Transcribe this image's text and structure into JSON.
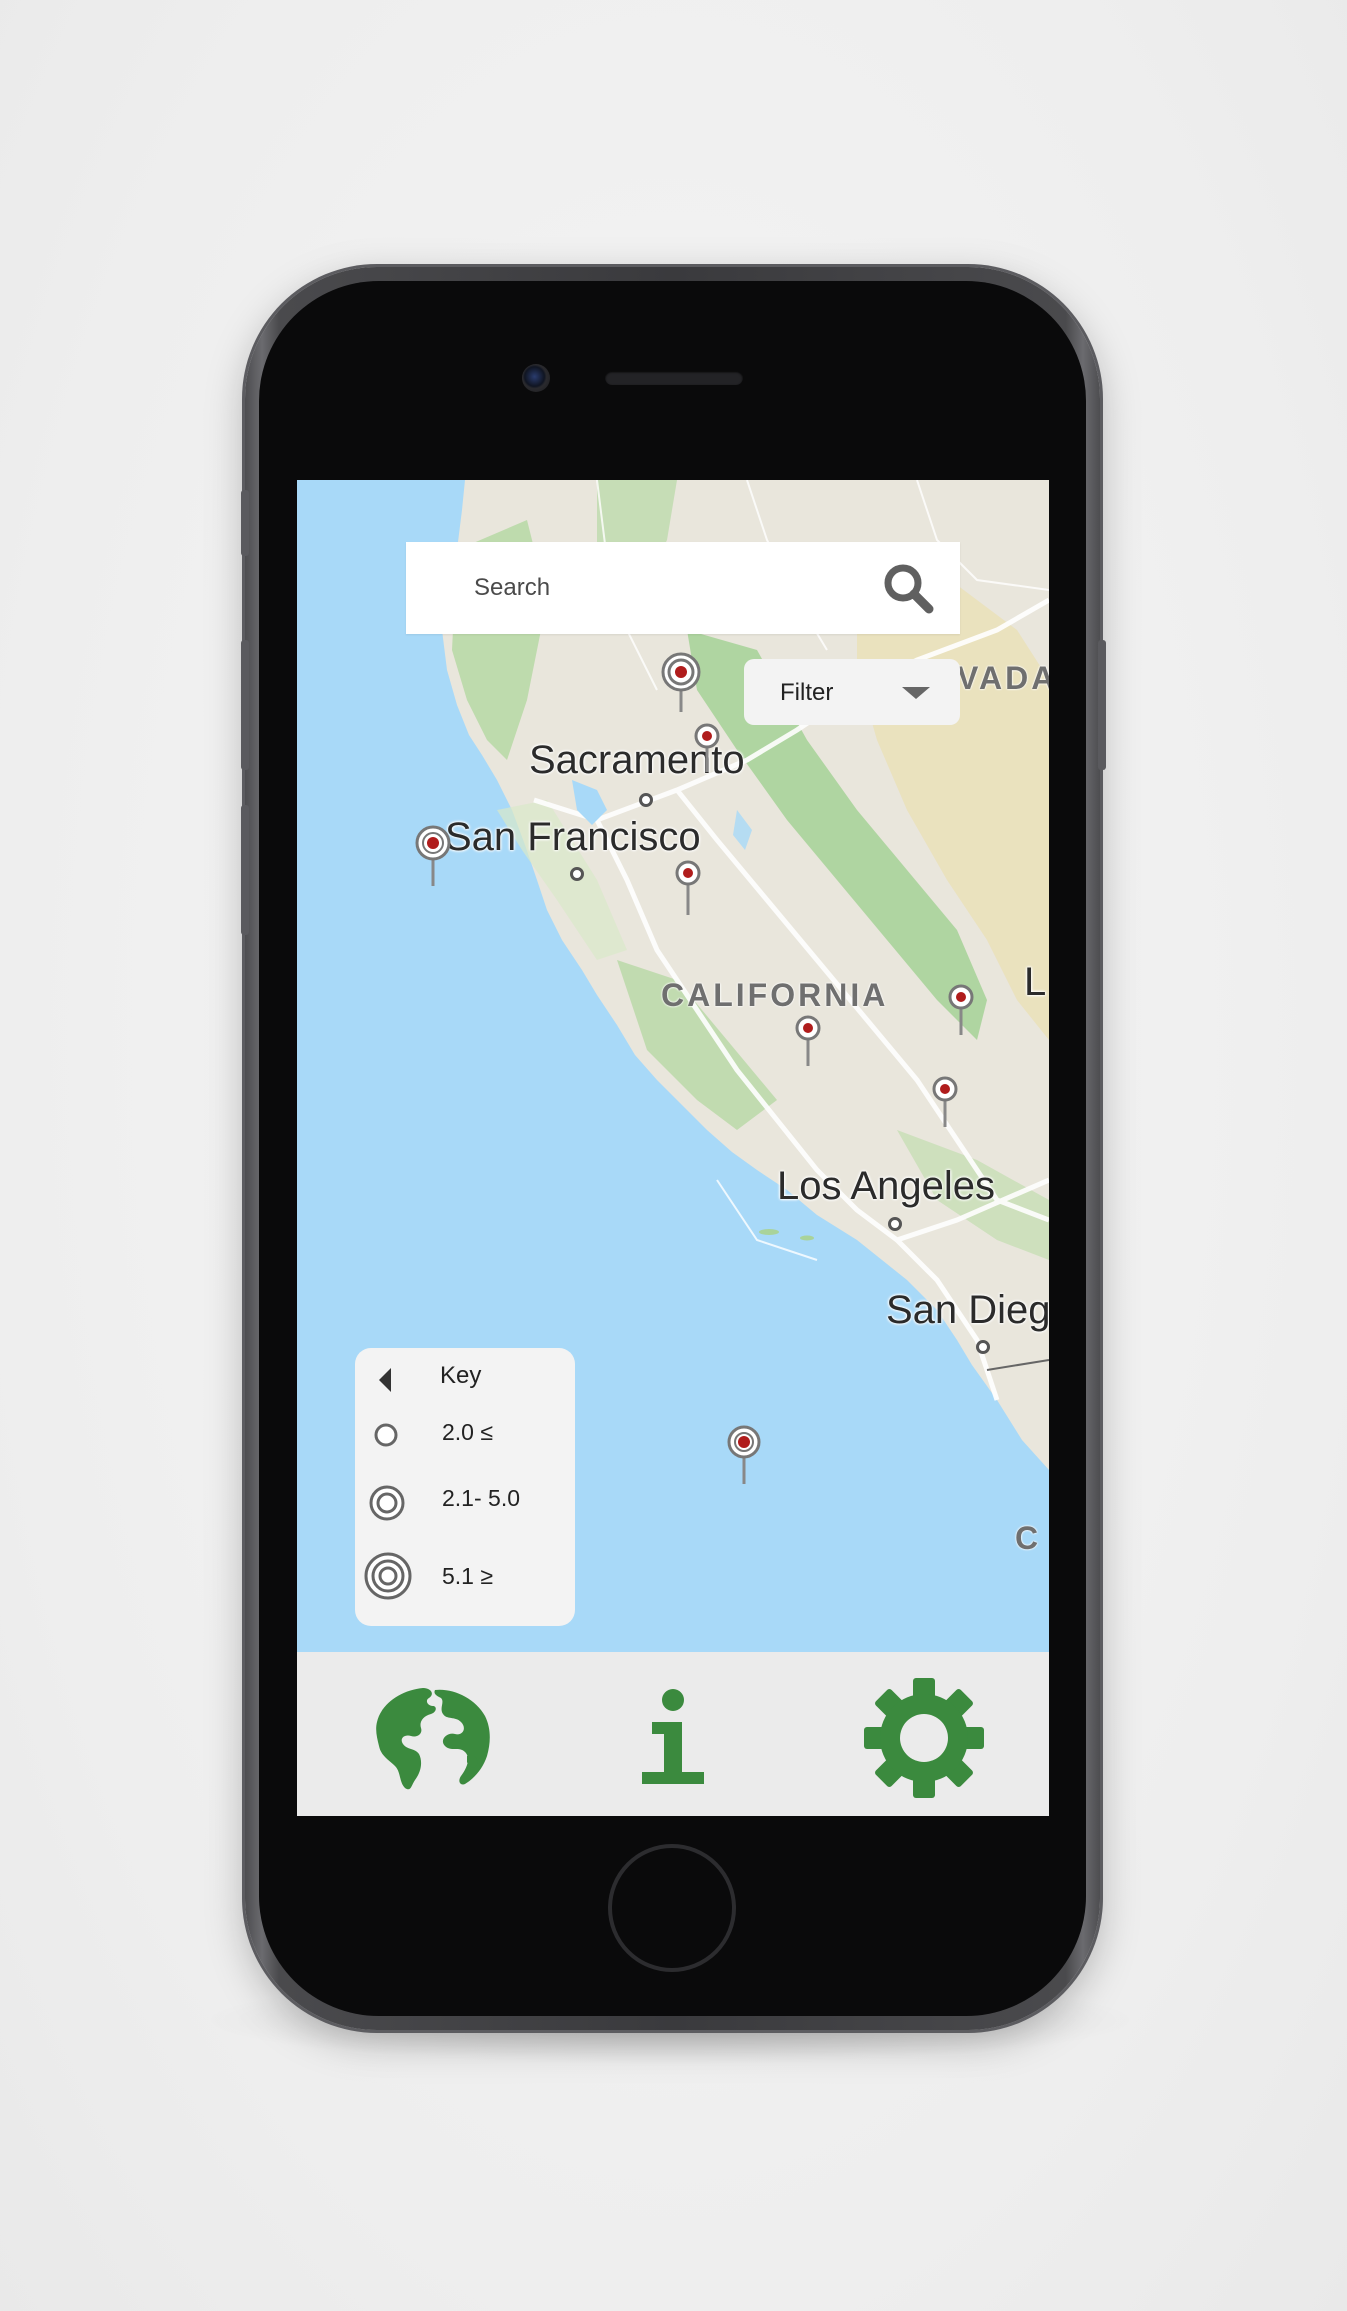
{
  "search": {
    "placeholder": "Search"
  },
  "filter": {
    "label": "Filter"
  },
  "map": {
    "labels": {
      "sacramento": "Sacramento",
      "san_francisco": "San Francisco",
      "california": "CALIFORNIA",
      "los_angeles": "Los Angeles",
      "san_diego": "San Dieg",
      "nevada": "VADA",
      "edge_l": "L",
      "edge_ca": "C"
    },
    "colors": {
      "ocean": "#a8d9f8",
      "land": "#e9e6dc",
      "forest": "#a9d39a",
      "pin_red": "#b01c1c"
    }
  },
  "key": {
    "title": "Key",
    "rows": [
      {
        "label": "2.0 ≤",
        "icon": "small-ring-icon"
      },
      {
        "label": "2.1- 5.0",
        "icon": "medium-ring-icon"
      },
      {
        "label": "5.1 ≥",
        "icon": "large-ring-icon"
      }
    ]
  },
  "tabbar": {
    "tabs": [
      {
        "icon": "globe-icon"
      },
      {
        "icon": "info-icon"
      },
      {
        "icon": "gear-icon"
      }
    ],
    "accent": "#3b8a3e"
  }
}
